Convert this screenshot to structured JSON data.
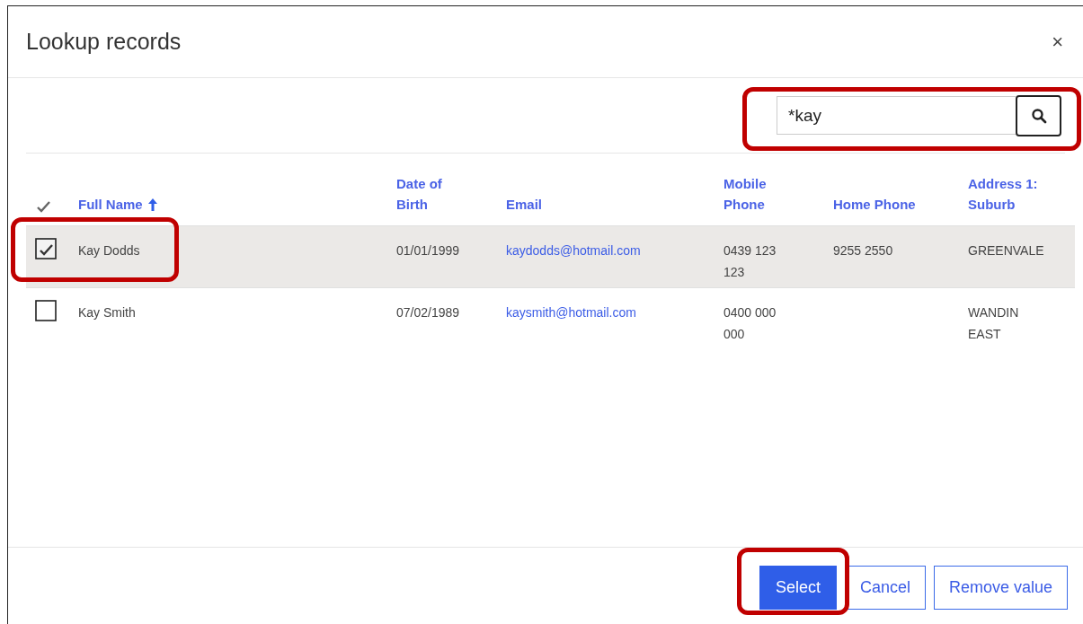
{
  "window": {
    "title": "Lookup records",
    "close": "×"
  },
  "search": {
    "value": "*kay"
  },
  "table": {
    "columns": [
      {
        "label": "Full Name",
        "sorted": true
      },
      {
        "label": "Date of Birth",
        "sorted": false
      },
      {
        "label": "Email",
        "sorted": false
      },
      {
        "label": "Mobile Phone",
        "sorted": false
      },
      {
        "label": "Home Phone",
        "sorted": false
      },
      {
        "label": "Address 1: Suburb",
        "sorted": false
      }
    ],
    "rows": [
      {
        "selected": true,
        "cells": [
          "Kay Dodds",
          "01/01/1999",
          "kaydodds@hotmail.com",
          "0439 123 123",
          "9255 2550",
          "GREENVALE"
        ]
      },
      {
        "selected": false,
        "cells": [
          "Kay Smith",
          "07/02/1989",
          "kaysmith@hotmail.com",
          "0400 000 000",
          "",
          "WANDIN EAST"
        ]
      }
    ]
  },
  "buttons": [
    {
      "label": "Select",
      "kind": "primary"
    },
    {
      "label": "Cancel",
      "kind": "secondary"
    },
    {
      "label": "Remove value",
      "kind": "secondary"
    }
  ]
}
